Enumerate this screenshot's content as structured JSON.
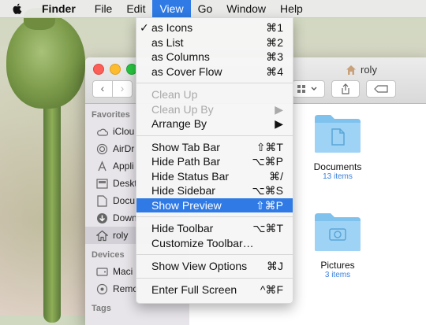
{
  "menubar": {
    "app": "Finder",
    "items": [
      "File",
      "Edit",
      "View",
      "Go",
      "Window",
      "Help"
    ],
    "active": "View",
    "highlight_color": "#2f7ae5"
  },
  "window": {
    "title": "roly",
    "sidebar": {
      "favorites_header": "Favorites",
      "favorites": [
        {
          "label": "iClou",
          "icon": "cloud-icon"
        },
        {
          "label": "AirDr",
          "icon": "airdrop-icon"
        },
        {
          "label": "Appli",
          "icon": "applications-icon"
        },
        {
          "label": "Deskt",
          "icon": "desktop-icon"
        },
        {
          "label": "Docu",
          "icon": "documents-icon"
        },
        {
          "label": "Down",
          "icon": "downloads-icon"
        },
        {
          "label": "roly",
          "icon": "home-icon",
          "selected": true
        }
      ],
      "devices_header": "Devices",
      "devices": [
        {
          "label": "Maci",
          "icon": "disk-icon"
        },
        {
          "label": "Remo",
          "icon": "remote-disc-icon"
        }
      ],
      "tags_header": "Tags"
    },
    "folders": [
      {
        "name": "Documents",
        "count": "13 items",
        "icon": "documents-folder-icon"
      },
      {
        "name": "Pictures",
        "count": "3 items",
        "icon": "pictures-folder-icon"
      }
    ]
  },
  "view_menu": {
    "groups": [
      [
        {
          "label": "as Icons",
          "shortcut": "⌘1",
          "checked": true
        },
        {
          "label": "as List",
          "shortcut": "⌘2"
        },
        {
          "label": "as Columns",
          "shortcut": "⌘3"
        },
        {
          "label": "as Cover Flow",
          "shortcut": "⌘4"
        }
      ],
      [
        {
          "label": "Clean Up",
          "shortcut": "",
          "disabled": true
        },
        {
          "label": "Clean Up By",
          "shortcut": "▶",
          "disabled": true
        },
        {
          "label": "Arrange By",
          "shortcut": "▶"
        }
      ],
      [
        {
          "label": "Show Tab Bar",
          "shortcut": "⇧⌘T"
        },
        {
          "label": "Hide Path Bar",
          "shortcut": "⌥⌘P"
        },
        {
          "label": "Hide Status Bar",
          "shortcut": "⌘/"
        },
        {
          "label": "Hide Sidebar",
          "shortcut": "⌥⌘S"
        },
        {
          "label": "Show Preview",
          "shortcut": "⇧⌘P",
          "highlighted": true
        }
      ],
      [
        {
          "label": "Hide Toolbar",
          "shortcut": "⌥⌘T"
        },
        {
          "label": "Customize Toolbar…",
          "shortcut": ""
        }
      ],
      [
        {
          "label": "Show View Options",
          "shortcut": "⌘J"
        }
      ],
      [
        {
          "label": "Enter Full Screen",
          "shortcut": "^⌘F"
        }
      ]
    ]
  }
}
